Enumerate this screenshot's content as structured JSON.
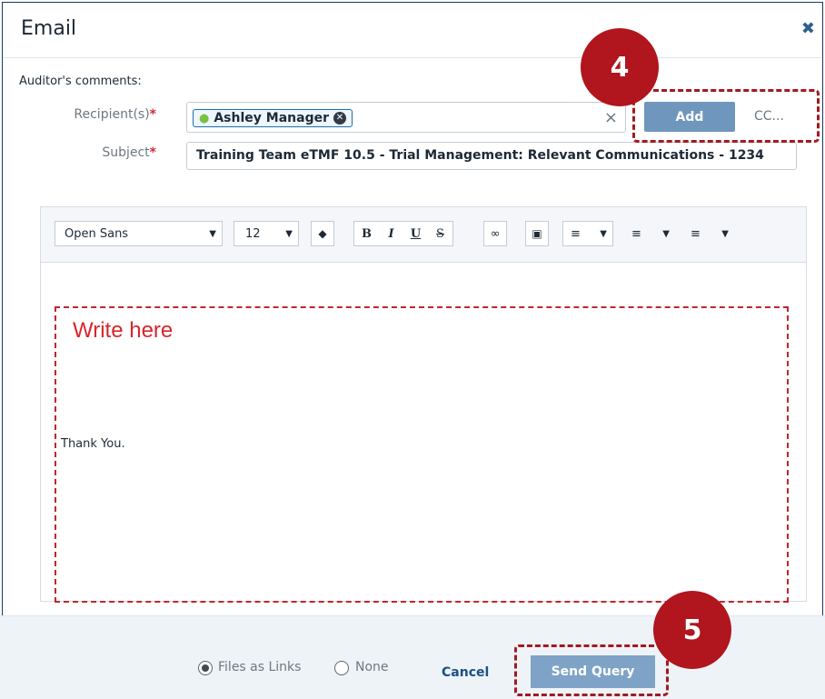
{
  "dialog": {
    "title": "Email"
  },
  "form": {
    "recipients_label": "Recipient(s)",
    "subject_label": "Subject",
    "required_mark": "*",
    "recipient_chip": "Ashley Manager",
    "add_label": "Add",
    "cc_label": "CC...",
    "subject_value": "Training Team eTMF 10.5 - Trial Management: Relevant Communications - 1234"
  },
  "toolbar": {
    "font_family": "Open Sans",
    "font_size": "12",
    "bold": "B",
    "italic": "I",
    "underline": "U",
    "strike": "S"
  },
  "editor": {
    "comments_label": "Auditor's comments:",
    "placeholder_annotation": "Write here",
    "closing": "Thank You."
  },
  "footer": {
    "files_as_links": "Files as Links",
    "none": "None",
    "cancel": "Cancel",
    "send": "Send Query"
  },
  "annotations": {
    "step4": "4",
    "step5": "5"
  },
  "colors": {
    "accent": "#6f97bd",
    "annotation": "#b1151d"
  }
}
